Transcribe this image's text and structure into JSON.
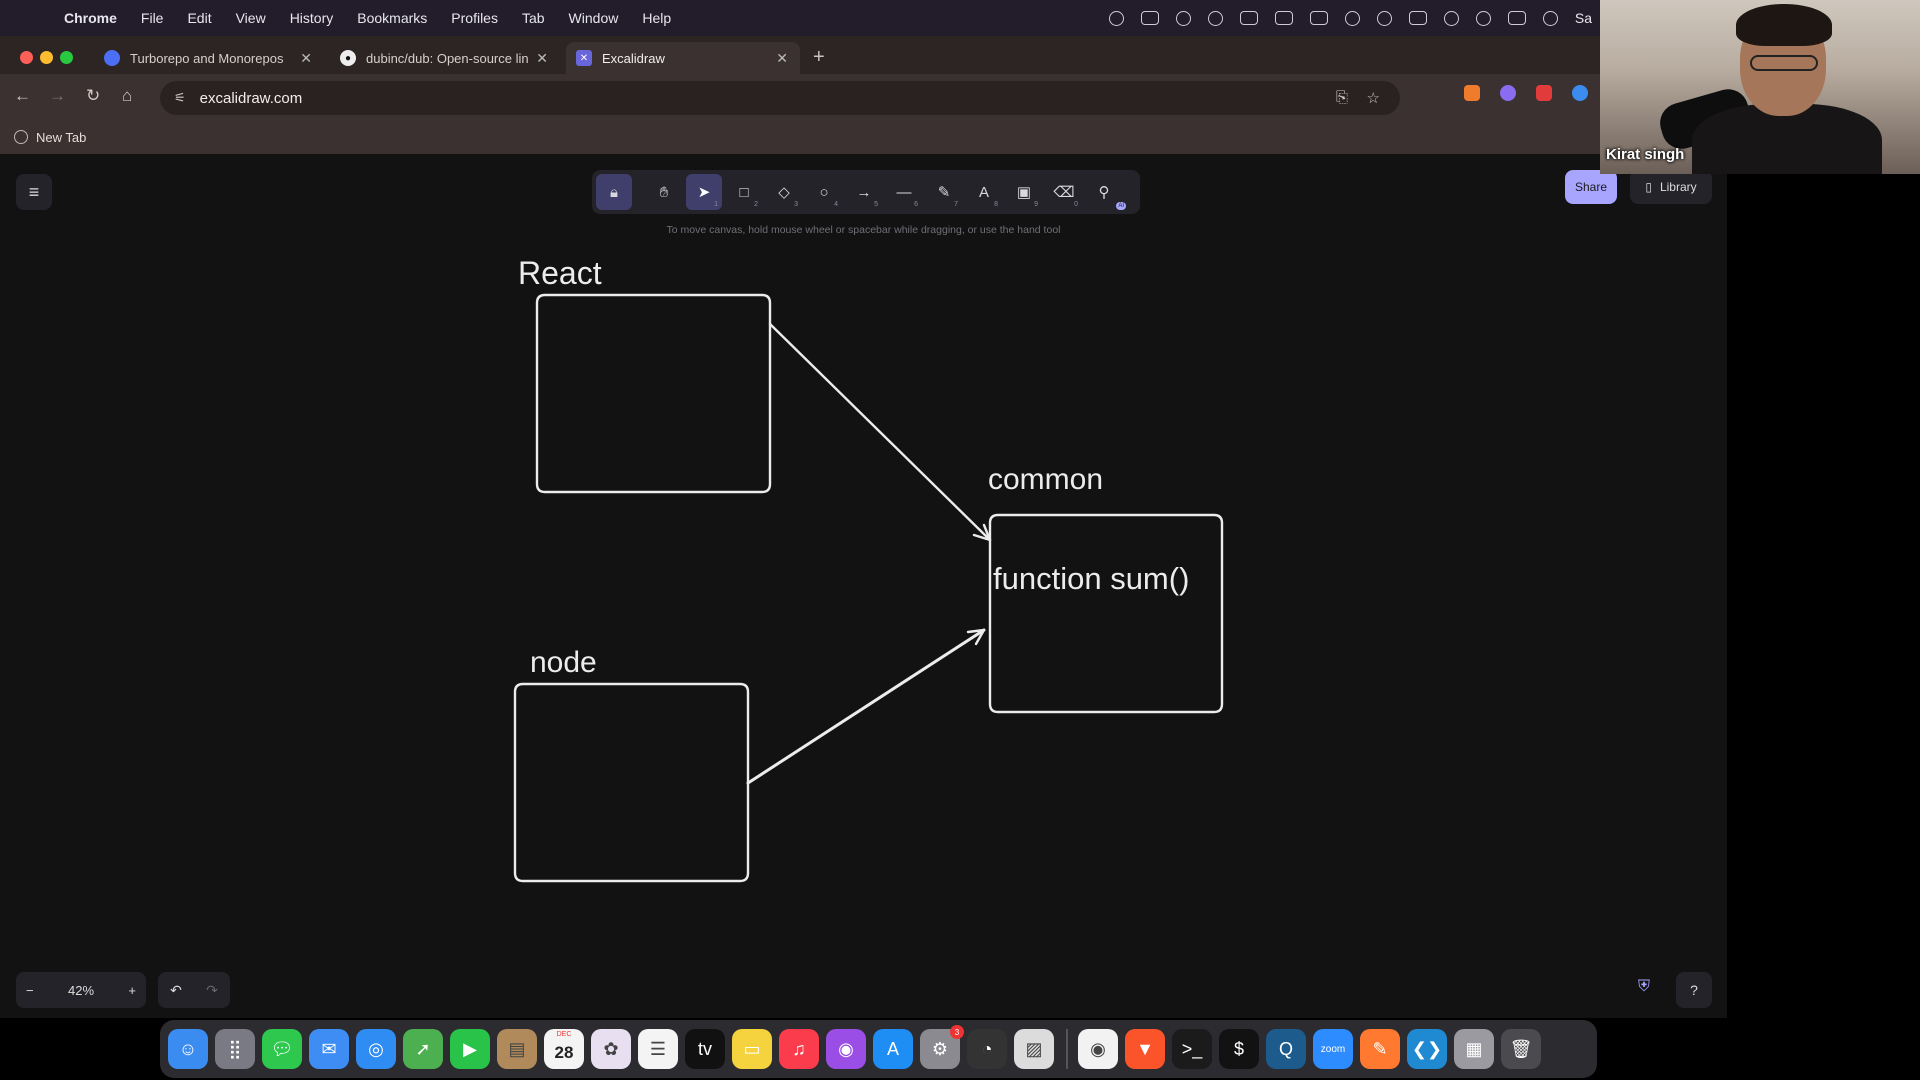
{
  "menubar": {
    "app_name": "Chrome",
    "items": [
      "File",
      "Edit",
      "View",
      "History",
      "Bookmarks",
      "Profiles",
      "Tab",
      "Window",
      "Help"
    ],
    "right_truncated": "Sa"
  },
  "browser": {
    "tabs": [
      {
        "title": "Turborepo and Monorepos",
        "active": false
      },
      {
        "title": "dubinc/dub: Open-source lin",
        "active": false
      },
      {
        "title": "Excalidraw",
        "active": true
      }
    ],
    "new_tab_symbol": "+",
    "url": "excalidraw.com",
    "bookmarks": [
      {
        "label": "New Tab"
      }
    ]
  },
  "excalidraw": {
    "toolbar": {
      "tools": [
        {
          "name": "lock",
          "glyph": "🔒︎",
          "key": ""
        },
        {
          "name": "hand",
          "glyph": "✋︎",
          "key": ""
        },
        {
          "name": "selection",
          "glyph": "➤",
          "key": "1"
        },
        {
          "name": "rectangle",
          "glyph": "□",
          "key": "2"
        },
        {
          "name": "diamond",
          "glyph": "◇",
          "key": "3"
        },
        {
          "name": "ellipse",
          "glyph": "○",
          "key": "4"
        },
        {
          "name": "arrow",
          "glyph": "→",
          "key": "5"
        },
        {
          "name": "line",
          "glyph": "—",
          "key": "6"
        },
        {
          "name": "draw",
          "glyph": "✎",
          "key": "7"
        },
        {
          "name": "text",
          "glyph": "A",
          "key": "8"
        },
        {
          "name": "image",
          "glyph": "▣",
          "key": "9"
        },
        {
          "name": "eraser",
          "glyph": "⌫",
          "key": "0"
        },
        {
          "name": "more-tools",
          "glyph": "⚲",
          "key": "",
          "badge": "AI"
        }
      ]
    },
    "hint": "To move canvas, hold mouse wheel or spacebar while dragging, or use the hand tool",
    "share_label": "Share",
    "library_label": "Library",
    "diagram": {
      "labels": {
        "react": "React",
        "common": "common",
        "node": "node",
        "function": "function sum()"
      }
    },
    "zoom": {
      "minus": "−",
      "value": "42%",
      "plus": "+"
    },
    "undo": "↶",
    "redo": "↷",
    "help": "?"
  },
  "webcam": {
    "name": "Kirat singh"
  },
  "dock": {
    "calendar_day": "28",
    "calendar_month": "DEC",
    "settings_badge": "3",
    "apps": [
      {
        "name": "finder",
        "color": "#3b8cf0",
        "glyph": "☺"
      },
      {
        "name": "launchpad",
        "color": "#7a7a85",
        "glyph": "⣿"
      },
      {
        "name": "messages",
        "color": "#2fc84f",
        "glyph": "💬︎"
      },
      {
        "name": "mail",
        "color": "#3d8df5",
        "glyph": "✉"
      },
      {
        "name": "safari",
        "color": "#2f8cf2",
        "glyph": "◎"
      },
      {
        "name": "maps",
        "color": "#4caf50",
        "glyph": "➚"
      },
      {
        "name": "facetime",
        "color": "#29c34a",
        "glyph": "▶"
      },
      {
        "name": "notes-brown",
        "color": "#b08a5a",
        "glyph": "▤"
      },
      {
        "name": "calendar",
        "color": "#f4f4f4",
        "glyph": ""
      },
      {
        "name": "photos",
        "color": "#e8e0f0",
        "glyph": "✿"
      },
      {
        "name": "reminders",
        "color": "#f4f4f4",
        "glyph": "☰"
      },
      {
        "name": "appletv",
        "color": "#111",
        "glyph": "tv"
      },
      {
        "name": "notes",
        "color": "#f5d33f",
        "glyph": "▭"
      },
      {
        "name": "music",
        "color": "#fa3c4c",
        "glyph": "♫"
      },
      {
        "name": "podcasts",
        "color": "#9a4ee6",
        "glyph": "◉"
      },
      {
        "name": "appstore",
        "color": "#1e8ef4",
        "glyph": "A"
      },
      {
        "name": "system-settings",
        "color": "#8a8a90",
        "glyph": "⚙"
      },
      {
        "name": "activity",
        "color": "#333",
        "glyph": "◔"
      },
      {
        "name": "preview",
        "color": "#dcdcdc",
        "glyph": "▨"
      }
    ],
    "apps_right": [
      {
        "name": "chrome",
        "color": "#f2f2f2",
        "glyph": "◉"
      },
      {
        "name": "brave",
        "color": "#fb542b",
        "glyph": "▼"
      },
      {
        "name": "terminal",
        "color": "#1b1b1b",
        "glyph": ">_"
      },
      {
        "name": "terminal-2",
        "color": "#121212",
        "glyph": "$"
      },
      {
        "name": "quicktime",
        "color": "#1c5b8c",
        "glyph": "Q"
      },
      {
        "name": "zoom",
        "color": "#2d8cff",
        "glyph": "zoom"
      },
      {
        "name": "pen-app",
        "color": "#ff7a30",
        "glyph": "✎"
      },
      {
        "name": "vscode",
        "color": "#1f8ad2",
        "glyph": "❮❯"
      },
      {
        "name": "downloads",
        "color": "#9a9aa0",
        "glyph": "▦"
      },
      {
        "name": "trash",
        "color": "#4a4a4f",
        "glyph": "🗑︎"
      }
    ]
  }
}
